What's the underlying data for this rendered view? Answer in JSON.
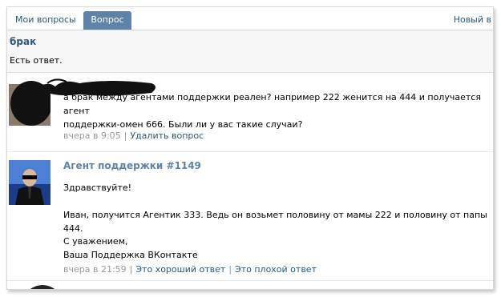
{
  "tabs": [
    {
      "label": "Мои вопросы"
    },
    {
      "label": "Вопрос"
    },
    {
      "label": "Новый в"
    }
  ],
  "question": {
    "title": "брак",
    "status": "Есть ответ."
  },
  "posts": [
    {
      "text_lines": [
        "а брак между агентами поддержки реален? например 222 женится на 444 и получается агент",
        "поддержки-омен 666. Были ли у вас такие случаи?"
      ],
      "time": "вчера в 9:05",
      "actions": [
        "Удалить вопрос"
      ]
    },
    {
      "author": "Агент поддержки #1149",
      "lines": [
        "Здравствуйте!",
        "Иван, получится Агентик 333. Ведь он возьмет половину от мамы 222 и половину от папы 444.",
        "С уважением,",
        "Ваша Поддержка ВКонтакте"
      ],
      "time": "вчера в 21:59",
      "actions": [
        "Это хороший ответ",
        "Это плохой ответ"
      ]
    }
  ],
  "colors": {
    "accent": "#5e82a8",
    "link": "#2b587a",
    "muted": "#999999"
  },
  "icons": {
    "user_avatar": "redacted-avatar",
    "agent_avatar": "agent-avatar"
  }
}
